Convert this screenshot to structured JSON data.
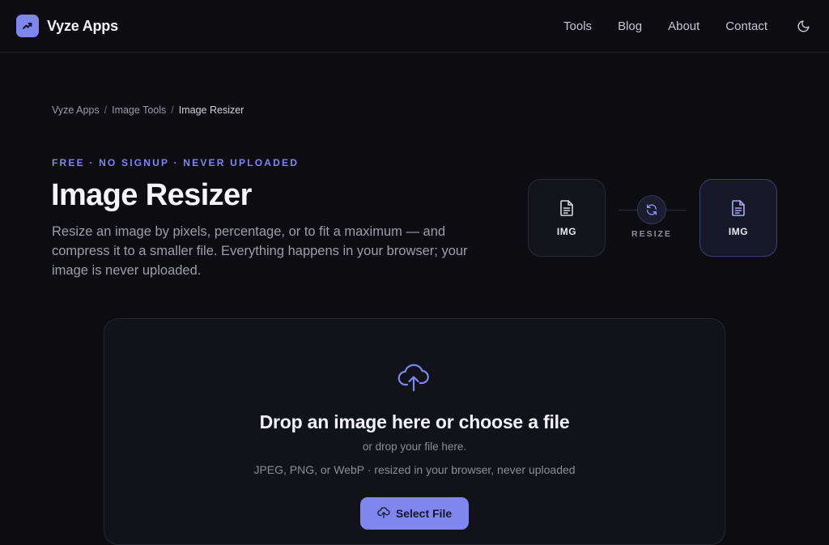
{
  "brand": {
    "name": "Vyze Apps",
    "accent": "#7f86ee"
  },
  "nav": {
    "items": [
      "Tools",
      "Blog",
      "About",
      "Contact"
    ]
  },
  "breadcrumb": {
    "items": [
      "Vyze Apps",
      "Image Tools",
      "Image Resizer"
    ],
    "separator": "/"
  },
  "hero": {
    "eyebrow": "FREE · NO SIGNUP · NEVER UPLOADED",
    "title": "Image Resizer",
    "description": "Resize an image by pixels, percentage, or to fit a maximum — and compress it to a smaller file. Everything happens in your browser; your image is never uploaded."
  },
  "conversion": {
    "source_label": "IMG",
    "target_label": "IMG",
    "action_label": "RESIZE"
  },
  "dropzone": {
    "title": "Drop an image here or choose a file",
    "subtitle": "or drop your file here.",
    "formats": "JPEG, PNG, or WebP · resized in your browser, never uploaded",
    "button_label": "Select File"
  },
  "icons": {
    "logo": "chart-arrow-icon",
    "theme": "moon-icon",
    "file": "document-icon",
    "convert": "refresh-icon",
    "upload": "cloud-upload-icon"
  }
}
